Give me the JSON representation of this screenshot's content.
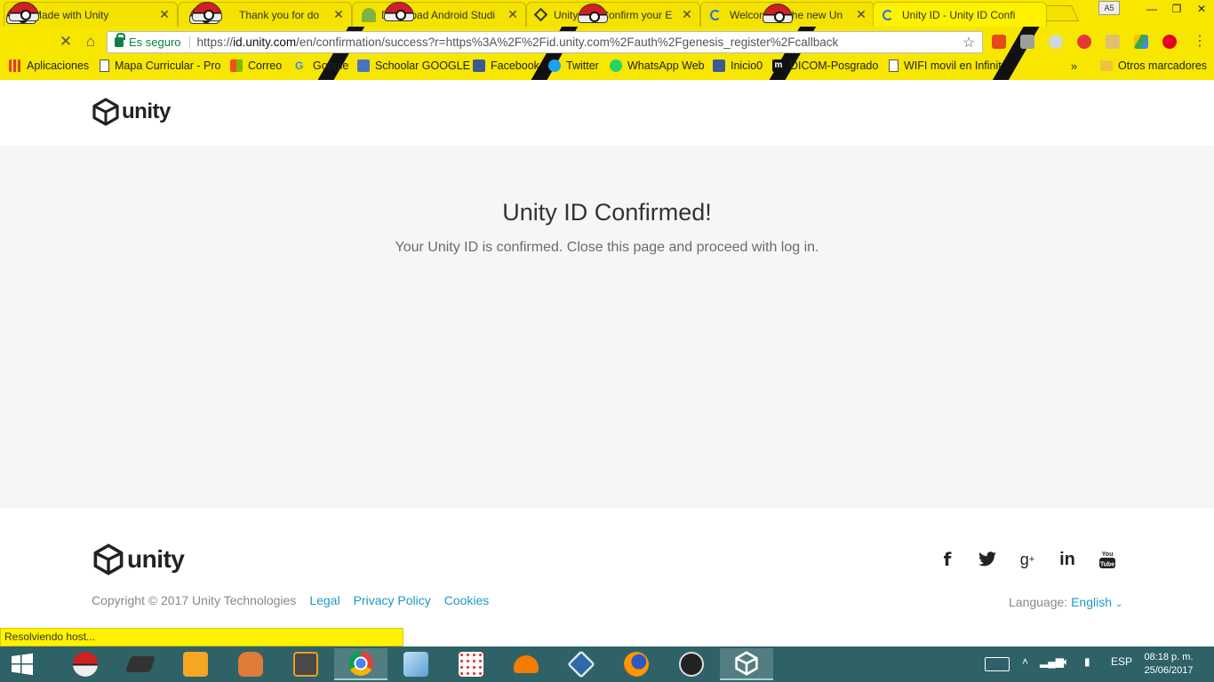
{
  "browser": {
    "tabs": [
      {
        "label": "Made with Unity"
      },
      {
        "label": "Thank you for do"
      },
      {
        "label": "Download Android Studi"
      },
      {
        "label": "Unity ID - Confirm your E"
      },
      {
        "label": "Welcome to the new Un"
      },
      {
        "label": "Unity ID - Unity ID Confi"
      }
    ],
    "ime_indicator": "A5",
    "omnibox": {
      "secure_label": "Es seguro",
      "url_prefix": "https://",
      "url_host": "id.unity.com",
      "url_path": "/en/confirmation/success?r=https%3A%2F%2Fid.unity.com%2Fauth%2Fgenesis_register%2Fcallback"
    },
    "bookmarks": [
      {
        "label": "Aplicaciones"
      },
      {
        "label": "Mapa Curricular - Pro"
      },
      {
        "label": "Correo"
      },
      {
        "label": "Google"
      },
      {
        "label": "Schoolar GOOGLE"
      },
      {
        "label": "Facebook"
      },
      {
        "label": "Twitter"
      },
      {
        "label": "WhatsApp Web"
      },
      {
        "label": "Inicio0"
      },
      {
        "label": "DICOM-Posgrado"
      },
      {
        "label": "WIFI movil en Infinitum"
      }
    ],
    "bookmarks_more": "»",
    "other_bookmarks": "Otros marcadores",
    "status_text": "Resolviendo host..."
  },
  "page": {
    "logo_text": "unity",
    "title": "Unity ID Confirmed!",
    "message": "Your Unity ID is confirmed. Close this page and proceed with log in.",
    "footer": {
      "logo_text": "unity",
      "copyright": "Copyright © 2017 Unity Technologies",
      "links": [
        "Legal",
        "Privacy Policy",
        "Cookies"
      ],
      "language_label": "Language:",
      "language_value": "English",
      "social": [
        "facebook-icon",
        "twitter-icon",
        "google-plus-icon",
        "linkedin-icon",
        "youtube-icon"
      ]
    }
  },
  "taskbar": {
    "language": "ESP",
    "time": "08:18 p. m.",
    "date": "25/06/2017"
  },
  "colors": {
    "chrome_theme": "#f7e600",
    "link_blue": "#2196c9",
    "hero_bg": "#f5f6f7",
    "taskbar": "#2e6266"
  }
}
